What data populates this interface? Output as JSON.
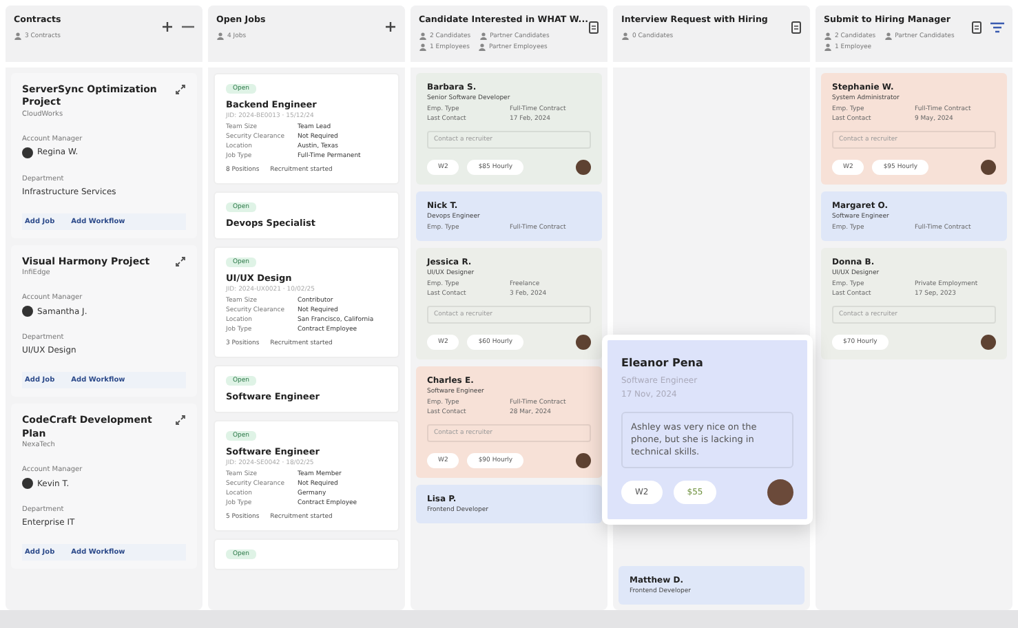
{
  "columns": [
    {
      "kind": "contracts",
      "title": "Contracts",
      "meta": [
        "3 Contracts"
      ],
      "cards": [
        {
          "title": "ServerSync Optimization Project",
          "company": "CloudWorks",
          "manager_label": "Account Manager",
          "manager": "Regina W.",
          "department_label": "Department",
          "department": "Infrastructure Services",
          "links": [
            "Add Job",
            "Add Workflow"
          ]
        },
        {
          "title": "Visual Harmony Project",
          "company": "InfiEdge",
          "manager_label": "Account Manager",
          "manager": "Samantha J.",
          "department_label": "Department",
          "department": "UI/UX Design",
          "links": [
            "Add Job",
            "Add Workflow"
          ]
        },
        {
          "title": "CodeCraft Development Plan",
          "company": "NexaTech",
          "manager_label": "Account Manager",
          "manager": "Kevin T.",
          "department_label": "Department",
          "department": "Enterprise IT",
          "links": [
            "Add Job",
            "Add Workflow"
          ]
        }
      ]
    },
    {
      "kind": "jobs",
      "title": "Open Jobs",
      "meta": [
        "4 Jobs"
      ],
      "cards": [
        {
          "badge": "Open",
          "title": "Backend Engineer",
          "ref": "JID: 2024-BE0013 · 15/12/24",
          "fields": [
            {
              "label": "Team Size",
              "value": "Team Lead"
            },
            {
              "label": "Security Clearance",
              "value": "Not Required"
            },
            {
              "label": "Location",
              "value": "Austin, Texas"
            },
            {
              "label": "Job Type",
              "value": "Full-Time Permanent"
            }
          ],
          "footer": [
            "8 Positions",
            "Recruitment started"
          ]
        },
        {
          "badge": "Open",
          "title": "Devops Specialist"
        },
        {
          "badge": "Open",
          "title": "UI/UX Design",
          "ref": "JID: 2024-UX0021 · 10/02/25",
          "fields": [
            {
              "label": "Team Size",
              "value": "Contributor"
            },
            {
              "label": "Security Clearance",
              "value": "Not Required"
            },
            {
              "label": "Location",
              "value": "San Francisco, California"
            },
            {
              "label": "Job Type",
              "value": "Contract Employee"
            }
          ],
          "footer": [
            "3 Positions",
            "Recruitment started"
          ]
        },
        {
          "badge": "Open",
          "title": "Software Engineer"
        },
        {
          "badge": "Open",
          "title": "Software Engineer",
          "ref": "JID: 2024-SE0042 · 18/02/25",
          "fields": [
            {
              "label": "Team Size",
              "value": "Team Member"
            },
            {
              "label": "Security Clearance",
              "value": "Not Required"
            },
            {
              "label": "Location",
              "value": "Germany"
            },
            {
              "label": "Job Type",
              "value": "Contract Employee"
            }
          ],
          "footer": [
            "5 Positions",
            "Recruitment started"
          ]
        },
        {
          "badge": "Open"
        }
      ]
    },
    {
      "kind": "candidates",
      "title": "Candidate Interested in WHAT W...",
      "meta": [
        "2 Candidates",
        "Partner Candidates",
        "1 Employees",
        "Partner Employees"
      ],
      "cards": [
        {
          "color": "#e9eee8",
          "name": "Barbara S.",
          "role": "Senior Software Developer",
          "fields": [
            {
              "label": "Emp. Type",
              "value": "Full-Time Contract"
            },
            {
              "label": "Last Contact",
              "value": "17 Feb, 2024"
            }
          ],
          "note": "Contact a recruiter",
          "chips": [
            "W2",
            "$85 Hourly"
          ]
        },
        {
          "color": "#dfe7f8",
          "name": "Nick T.",
          "role": "Devops Engineer",
          "fields": [
            {
              "label": "Emp. Type",
              "value": "Full-Time Contract"
            }
          ]
        },
        {
          "color": "#eceee9",
          "name": "Jessica R.",
          "role": "UI/UX Designer",
          "fields": [
            {
              "label": "Emp. Type",
              "value": "Freelance"
            },
            {
              "label": "Last Contact",
              "value": "3 Feb, 2024"
            }
          ],
          "note": "Contact a recruiter",
          "chips": [
            "W2",
            "$60 Hourly"
          ]
        },
        {
          "color": "#f7e1d7",
          "name": "Charles E.",
          "role": "Software Engineer",
          "fields": [
            {
              "label": "Emp. Type",
              "value": "Full-Time Contract"
            },
            {
              "label": "Last Contact",
              "value": "28 Mar, 2024"
            }
          ],
          "note": "Contact a recruiter",
          "chips": [
            "W2",
            "$90 Hourly"
          ]
        },
        {
          "color": "#dfe7f8",
          "name": "Lisa P.",
          "role": "Frontend Developer"
        }
      ]
    },
    {
      "kind": "candidates",
      "title": "Interview Request with Hiring",
      "meta": [
        "0 Candidates"
      ],
      "cards": [
        {
          "color": "#dfe7f8",
          "name": "Matthew D.",
          "role": "Frontend Developer"
        }
      ]
    },
    {
      "kind": "candidates",
      "title": "Submit to Hiring Manager",
      "meta": [
        "2 Candidates",
        "Partner Candidates",
        "1 Employee"
      ],
      "filterable": true,
      "cards": [
        {
          "color": "#f7e1d7",
          "name": "Stephanie W.",
          "role": "System Administrator",
          "fields": [
            {
              "label": "Emp. Type",
              "value": "Full-Time Contract"
            },
            {
              "label": "Last Contact",
              "value": "9 May, 2024"
            }
          ],
          "note": "Contact a recruiter",
          "chips": [
            "W2",
            "$95 Hourly"
          ]
        },
        {
          "color": "#dfe7f8",
          "name": "Margaret O.",
          "role": "Software Engineer",
          "fields": [
            {
              "label": "Emp. Type",
              "value": "Full-Time Contract"
            }
          ]
        },
        {
          "color": "#eceee9",
          "name": "Donna B.",
          "role": "UI/UX Designer",
          "fields": [
            {
              "label": "Emp. Type",
              "value": "Private Employment"
            },
            {
              "label": "Last Contact",
              "value": "17 Sep, 2023"
            }
          ],
          "note": "Contact a recruiter",
          "chips": [
            "$70 Hourly"
          ]
        }
      ]
    }
  ],
  "popup": {
    "name": "Eleanor Pena",
    "role": "Software Engineer",
    "date": "17 Nov, 2024",
    "note": "Ashley was very nice on the phone, but she is lacking in technical skills.",
    "chips": [
      "W2",
      "$55"
    ]
  }
}
